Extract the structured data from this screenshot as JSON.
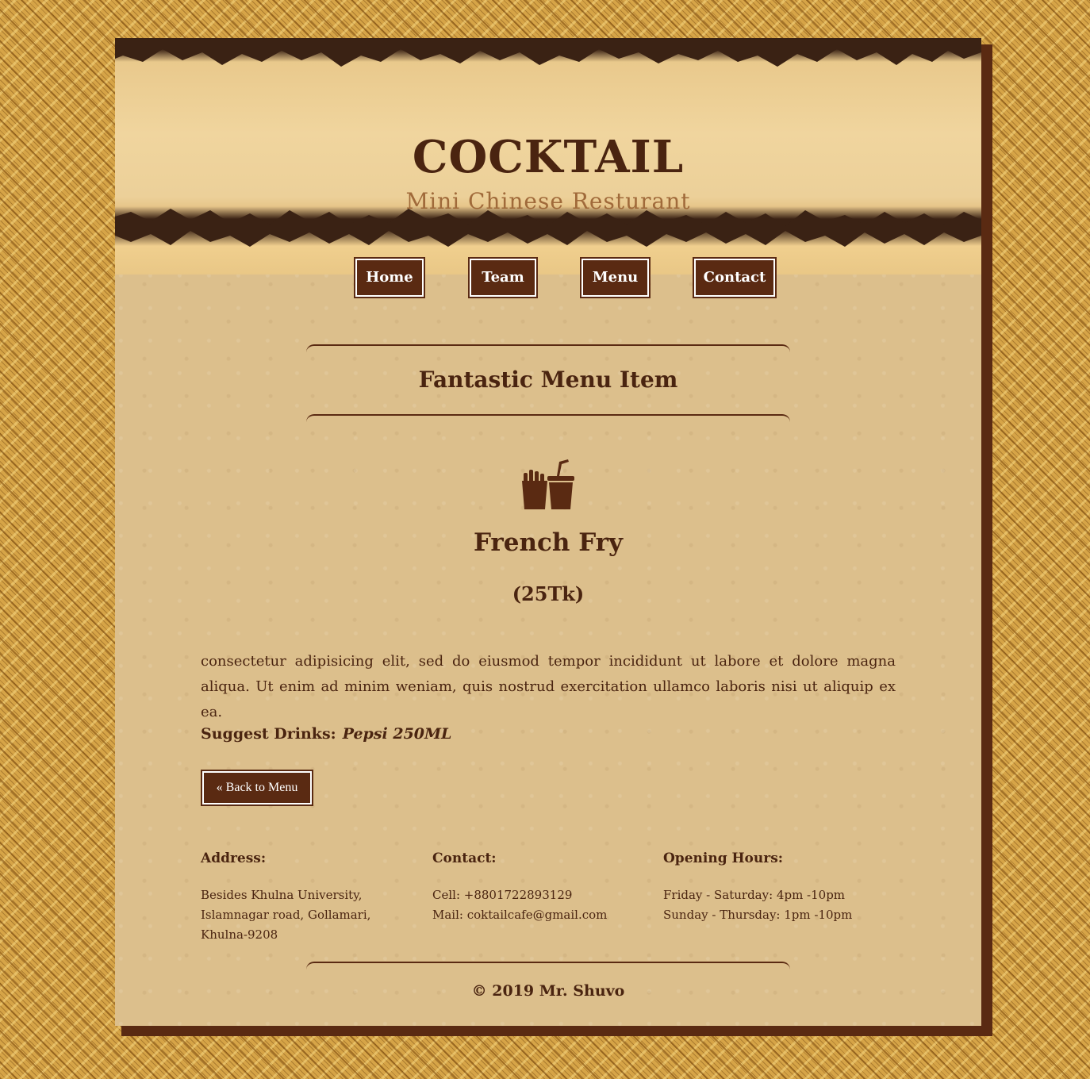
{
  "site": {
    "title": "COCKTAIL",
    "subtitle": "Mini Chinese Resturant"
  },
  "nav": {
    "items": [
      {
        "label": "Home"
      },
      {
        "label": "Team"
      },
      {
        "label": "Menu"
      },
      {
        "label": "Contact"
      }
    ]
  },
  "section": {
    "title": "Fantastic Menu Item"
  },
  "item": {
    "icon": "fries-and-drink-icon",
    "name": "French Fry",
    "price": "(25Tk)",
    "description": "consectetur adipisicing elit, sed do eiusmod tempor incididunt ut labore et dolore magna aliqua. Ut enim ad minim weniam, quis nostrud exercitation ullamco laboris nisi ut aliquip ex ea.",
    "suggest_label": "Suggest Drinks:",
    "suggest_drink": "Pepsi 250ML"
  },
  "back_button": {
    "label": "« Back to Menu"
  },
  "footer": {
    "address": {
      "heading": "Address:",
      "lines": [
        "Besides Khulna University,",
        "Islamnagar road, Gollamari,",
        "Khulna-9208"
      ]
    },
    "contact": {
      "heading": "Contact:",
      "lines": [
        "Cell: +8801722893129",
        "Mail: coktailcafe@gmail.com"
      ]
    },
    "hours": {
      "heading": "Opening Hours:",
      "lines": [
        "Friday - Saturday: 4pm -10pm",
        "Sunday - Thursday: 1pm -10pm"
      ]
    },
    "copyright": "© 2019 Mr. Shuvo"
  },
  "colors": {
    "brand_brown": "#5a2a12",
    "paper": "#dcbf8c",
    "subtitle": "#a06a3a",
    "wicker": "#d6a447"
  }
}
